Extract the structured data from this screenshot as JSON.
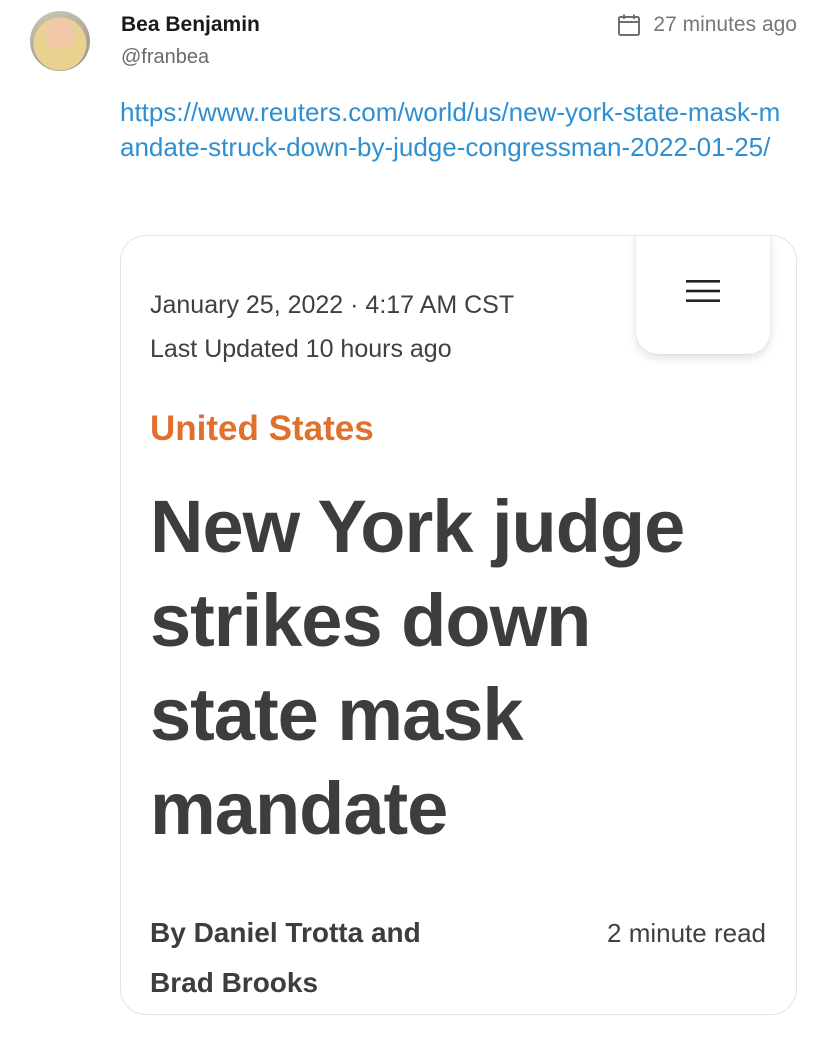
{
  "post": {
    "author_name": "Bea Benjamin",
    "author_handle": "@franbea",
    "timestamp": "27 minutes ago",
    "link_text": "https://www.reuters.com/world/us/new-york-state-mask-mandate-struck-down-by-judge-congressman-2022-01-25/"
  },
  "icons": {
    "timestamp": "calendar-icon",
    "menu": "hamburger-menu-icon",
    "avatar": "profile-photo"
  },
  "article": {
    "date": "January 25, 2022 · 4:17 AM CST",
    "updated": "Last Updated 10 hours ago",
    "section": "United States",
    "headline": "New York judge strikes down state mask mandate",
    "byline": "By Daniel Trotta and Brad Brooks",
    "read_time": "2 minute read"
  },
  "colors": {
    "link": "#2f8fd0",
    "section_accent": "#e0702b",
    "headline": "#3d3d3d",
    "muted": "#777777"
  }
}
